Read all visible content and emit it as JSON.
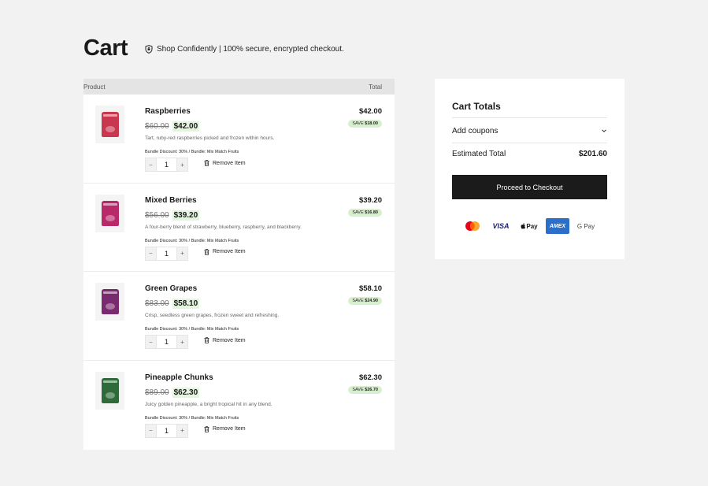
{
  "page": {
    "title": "Cart",
    "secure_text": "Shop Confidently | 100% secure, encrypted checkout."
  },
  "cart": {
    "header_product": "Product",
    "header_total": "Total",
    "remove_label": "Remove Item",
    "items": [
      {
        "name": "Raspberries",
        "old_price": "$60.00",
        "new_price": "$42.00",
        "description": "Tart, ruby-red raspberries picked and frozen within hours.",
        "bundle": "Bundle Discount: 30% / Bundle: Mix Match Fruits",
        "quantity": "1",
        "total": "$42.00",
        "save_label": "SAVE",
        "save_amount": "$18.00",
        "pack_color": "#c9374e"
      },
      {
        "name": "Mixed Berries",
        "old_price": "$56.00",
        "new_price": "$39.20",
        "description": "A four-berry blend of strawberry, blueberry, raspberry, and blackberry.",
        "bundle": "Bundle Discount: 30% / Bundle: Mix Match Fruits",
        "quantity": "1",
        "total": "$39.20",
        "save_label": "SAVE",
        "save_amount": "$16.80",
        "pack_color": "#b8296a"
      },
      {
        "name": "Green Grapes",
        "old_price": "$83.00",
        "new_price": "$58.10",
        "description": "Crisp, seedless green grapes, frozen sweet and refreshing.",
        "bundle": "Bundle Discount: 30% / Bundle: Mix Match Fruits",
        "quantity": "1",
        "total": "$58.10",
        "save_label": "SAVE",
        "save_amount": "$24.90",
        "pack_color": "#7a2a6e"
      },
      {
        "name": "Pineapple Chunks",
        "old_price": "$89.00",
        "new_price": "$62.30",
        "description": "Juicy golden pineapple, a bright tropical hit in any blend.",
        "bundle": "Bundle Discount: 30% / Bundle: Mix Match Fruits",
        "quantity": "1",
        "total": "$62.30",
        "save_label": "SAVE",
        "save_amount": "$26.70",
        "pack_color": "#2f6b3a"
      }
    ]
  },
  "totals": {
    "title": "Cart Totals",
    "coupons_label": "Add coupons",
    "estimated_label": "Estimated Total",
    "estimated_amount": "$201.60",
    "checkout_label": "Proceed to Checkout",
    "payment_methods": [
      "mastercard",
      "VISA",
      "Pay",
      "AMEX",
      "G Pay"
    ]
  }
}
